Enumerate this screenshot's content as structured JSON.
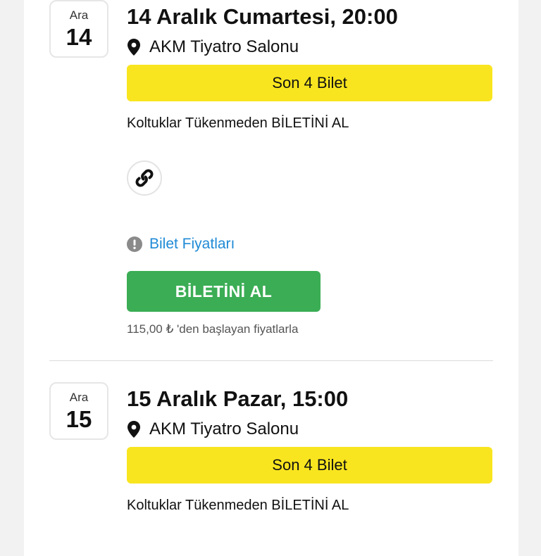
{
  "events": [
    {
      "month": "Ara",
      "day": "14",
      "title": "14 Aralık Cumartesi, 20:00",
      "venue": "AKM Tiyatro Salonu",
      "banner": "Son 4 Bilet",
      "hurry_text": "Koltuklar Tükenmeden BİLETİNİ AL",
      "prices_link": "Bilet Fiyatları",
      "buy_label": "BİLETİNİ AL",
      "price_note": "115,00 ₺ 'den başlayan fiyatlarla"
    },
    {
      "month": "Ara",
      "day": "15",
      "title": "15 Aralık Pazar, 15:00",
      "venue": "AKM Tiyatro Salonu",
      "banner": "Son 4 Bilet",
      "hurry_text": "Koltuklar Tükenmeden BİLETİNİ AL"
    }
  ],
  "icons": {
    "location": "location-pin-icon",
    "link": "link-icon",
    "info": "exclamation-circle-icon"
  },
  "colors": {
    "banner_yellow": "#f9e51f",
    "buy_green": "#3bad55",
    "link_blue": "#1f8ad6",
    "background": "#f2f2f2"
  }
}
